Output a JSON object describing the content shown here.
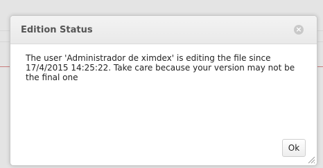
{
  "dialog": {
    "title": "Edition Status",
    "message": "The user 'Administrador de ximdex' is editing the file since 17/4/2015 14:25:22. Take care because your version may not be the final one",
    "ok_label": "Ok",
    "close_icon": "close-icon",
    "resize_icon": "resize-grip-icon"
  },
  "colors": {
    "title_text": "#555555",
    "titlebar_bg": "#eeeeee",
    "backdrop_accent": "#c97b7b"
  }
}
